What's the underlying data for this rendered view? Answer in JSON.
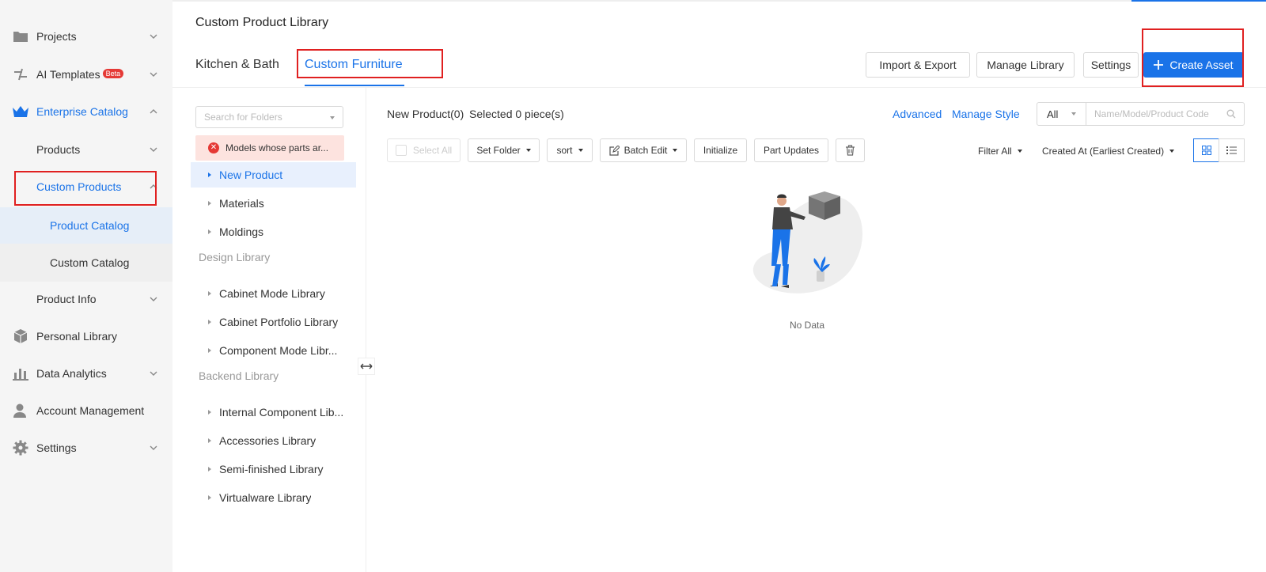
{
  "sidebar": {
    "items": [
      {
        "label": "Projects",
        "icon": "folder-icon"
      },
      {
        "label": "AI Templates",
        "badge": "Beta",
        "icon": "ai-icon"
      },
      {
        "label": "Enterprise Catalog",
        "icon": "crown-icon"
      },
      {
        "label": "Products"
      },
      {
        "label": "Custom Products"
      },
      {
        "label": "Product Catalog"
      },
      {
        "label": "Custom Catalog"
      },
      {
        "label": "Product Info"
      },
      {
        "label": "Personal Library",
        "icon": "cube-icon"
      },
      {
        "label": "Data Analytics",
        "icon": "bar-chart-icon"
      },
      {
        "label": "Account Management",
        "icon": "user-icon"
      },
      {
        "label": "Settings",
        "icon": "gear-icon"
      }
    ]
  },
  "header": {
    "title": "Custom Product Library",
    "tabs": [
      {
        "label": "Kitchen & Bath"
      },
      {
        "label": "Custom Furniture"
      }
    ],
    "buttons": {
      "import_export": "Import & Export",
      "manage_library": "Manage Library",
      "settings": "Settings",
      "create_asset": "Create Asset"
    }
  },
  "folders": {
    "search_placeholder": "Search for Folders",
    "alert": "Models whose parts ar...",
    "items": [
      "New Product",
      "Materials",
      "Moldings"
    ],
    "sections": [
      {
        "title": "Design Library",
        "items": [
          "Cabinet Mode Library",
          "Cabinet Portfolio Library",
          "Component Mode Libr..."
        ]
      },
      {
        "title": "Backend Library",
        "items": [
          "Internal Component Lib...",
          "Accessories Library",
          "Semi-finished Library",
          "Virtualware Library"
        ]
      }
    ]
  },
  "content": {
    "folder_count": "New Product(0)",
    "selected": "Selected 0 piece(s)",
    "advanced": "Advanced",
    "manage_style": "Manage Style",
    "search_scope": "All",
    "search_placeholder": "Name/Model/Product Code",
    "toolbar": {
      "select_all": "Select All",
      "set_folder": "Set Folder",
      "sort": "sort",
      "batch_edit": "Batch Edit",
      "initialize": "Initialize",
      "part_updates": "Part Updates"
    },
    "filter": "Filter All",
    "sort_order": "Created At (Earliest Created)",
    "empty_text": "No Data"
  },
  "colors": {
    "accent": "#1a73e8",
    "highlight": "#e02020"
  }
}
